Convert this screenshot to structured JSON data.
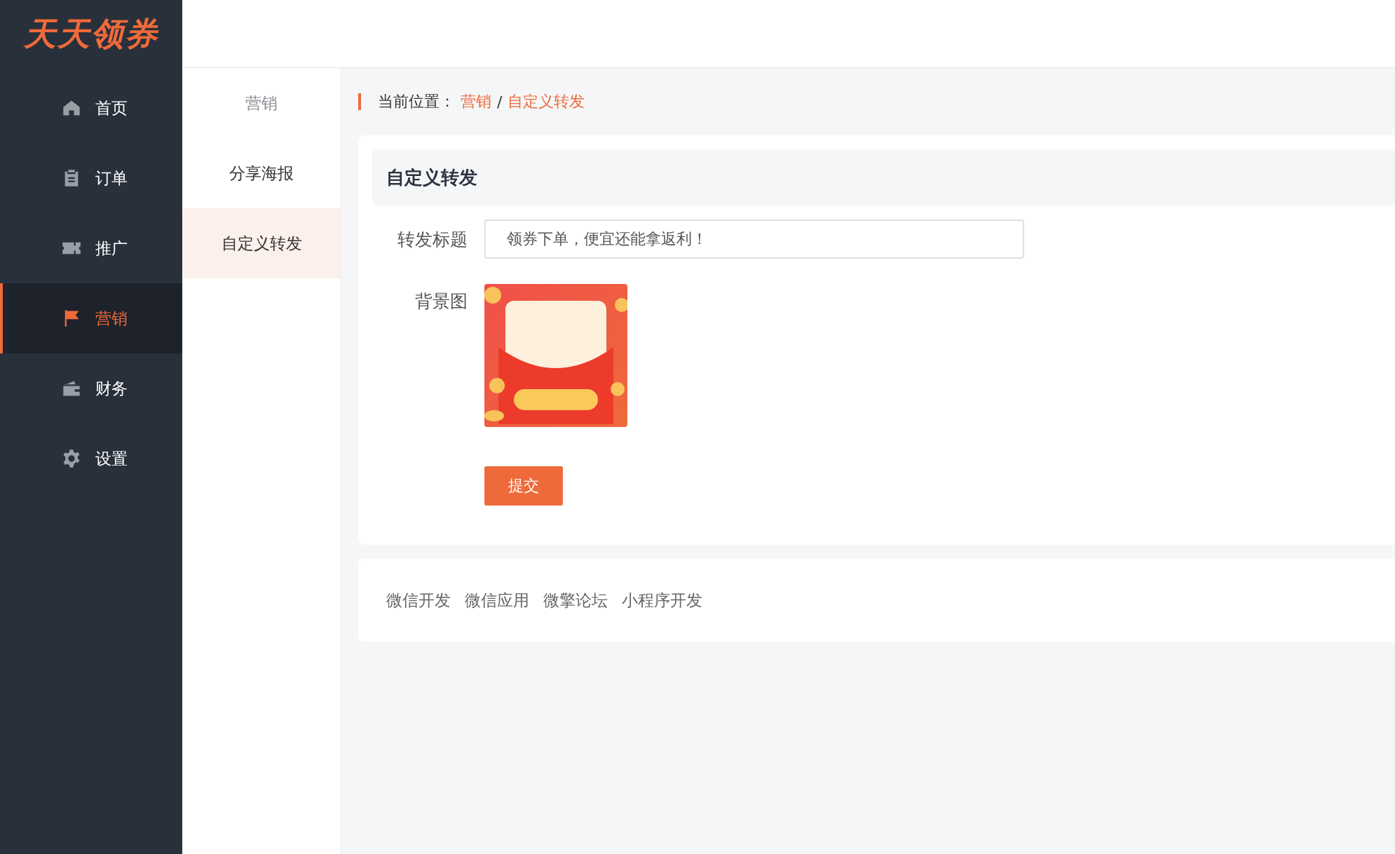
{
  "logo": "天天领券",
  "sidebar": {
    "items": [
      {
        "label": "首页",
        "kind": "home",
        "selected": false
      },
      {
        "label": "订单",
        "kind": "orders",
        "selected": false
      },
      {
        "label": "推广",
        "kind": "promotion",
        "selected": false
      },
      {
        "label": "营销",
        "kind": "marketing",
        "selected": true
      },
      {
        "label": "财务",
        "kind": "finance",
        "selected": false
      },
      {
        "label": "设置",
        "kind": "settings",
        "selected": false
      }
    ]
  },
  "submenu": {
    "title": "营销",
    "items": [
      {
        "label": "分享海报",
        "selected": false
      },
      {
        "label": "自定义转发",
        "selected": true
      }
    ]
  },
  "breadcrumb": {
    "label": "当前位置：",
    "path": [
      "营销",
      "自定义转发"
    ],
    "separator": "/"
  },
  "panel": {
    "title": "自定义转发",
    "fields": [
      {
        "kind": "text",
        "label": "转发标题",
        "value": "领券下单，便宜还能拿返利！"
      },
      {
        "kind": "image",
        "label": "背景图"
      }
    ],
    "submit": "提交"
  },
  "footer_links": [
    "微信开发",
    "微信应用",
    "微擎论坛",
    "小程序开发"
  ]
}
